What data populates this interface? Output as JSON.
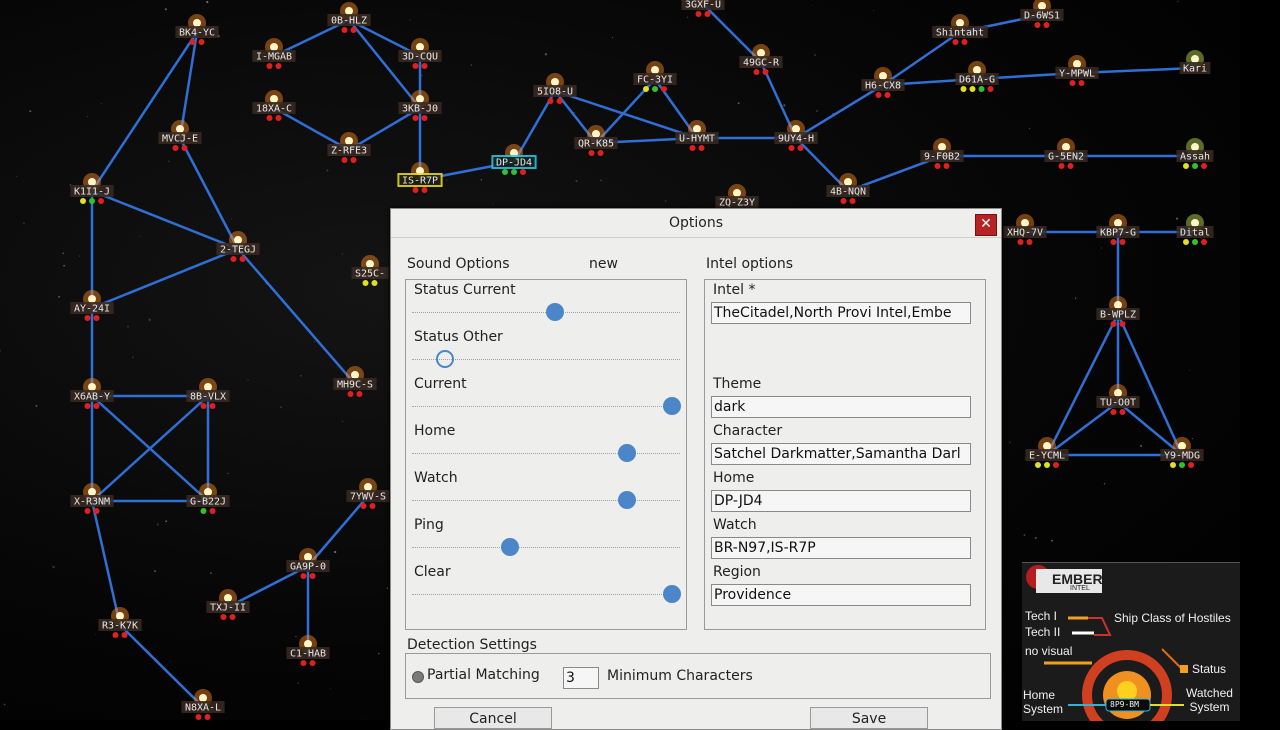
{
  "map": {
    "systems": [
      {
        "name": "BK4-YC",
        "dots": [
          "r",
          "r"
        ]
      },
      {
        "name": "0B-HLZ",
        "dots": [
          "r",
          "r"
        ]
      },
      {
        "name": "I-MGAB",
        "dots": [
          "r",
          "r"
        ]
      },
      {
        "name": "3D-CQU",
        "dots": [
          "r",
          "r"
        ]
      },
      {
        "name": "18XA-C",
        "dots": [
          "r",
          "r"
        ]
      },
      {
        "name": "3KB-J0",
        "dots": [
          "r",
          "r"
        ]
      },
      {
        "name": "MVCJ-E",
        "dots": [
          "r",
          "r"
        ]
      },
      {
        "name": "Z-RFE3",
        "dots": [
          "r",
          "r"
        ]
      },
      {
        "name": "IS-R7P",
        "dots": [
          "r",
          "r"
        ]
      },
      {
        "name": "DP-JD4",
        "dots": [
          "g",
          "g",
          "r"
        ]
      },
      {
        "name": "5IO8-U",
        "dots": [
          "r",
          "r"
        ]
      },
      {
        "name": "FC-3YI",
        "dots": [
          "y",
          "g",
          "r"
        ]
      },
      {
        "name": "QR-K85",
        "dots": [
          "r",
          "r"
        ]
      },
      {
        "name": "U-HYMT",
        "dots": [
          "r",
          "r"
        ]
      },
      {
        "name": "9UY4-H",
        "dots": [
          "r",
          "r"
        ]
      },
      {
        "name": "3GXF-U",
        "dots": [
          "r",
          "r"
        ]
      },
      {
        "name": "49GC-R",
        "dots": [
          "r",
          "r"
        ]
      },
      {
        "name": "Shintaht",
        "dots": [
          "r",
          "r"
        ]
      },
      {
        "name": "D-6WS1",
        "dots": [
          "r",
          "r"
        ]
      },
      {
        "name": "H6-CX8",
        "dots": [
          "r",
          "r"
        ]
      },
      {
        "name": "D61A-G",
        "dots": [
          "y",
          "y",
          "g",
          "r"
        ]
      },
      {
        "name": "Y-MPWL",
        "dots": [
          "r",
          "r"
        ]
      },
      {
        "name": "Kari",
        "dots": []
      },
      {
        "name": "9-F0B2",
        "dots": [
          "r",
          "r"
        ]
      },
      {
        "name": "G-5EN2",
        "dots": [
          "r",
          "r"
        ]
      },
      {
        "name": "Assah",
        "dots": [
          "y",
          "g",
          "r"
        ]
      },
      {
        "name": "4B-NQN",
        "dots": [
          "r",
          "r"
        ]
      },
      {
        "name": "ZQ-Z3Y",
        "dots": []
      },
      {
        "name": "XHQ-7V",
        "dots": [
          "r",
          "r"
        ]
      },
      {
        "name": "KBP7-G",
        "dots": [
          "r",
          "r"
        ]
      },
      {
        "name": "Dital",
        "dots": [
          "y",
          "g",
          "r"
        ]
      },
      {
        "name": "K1I1-J",
        "dots": [
          "y",
          "g",
          "r"
        ]
      },
      {
        "name": "2-TEGJ",
        "dots": [
          "r",
          "r"
        ]
      },
      {
        "name": "AY-24I",
        "dots": [
          "r",
          "r"
        ]
      },
      {
        "name": "S25C-",
        "dots": [
          "y",
          "y"
        ]
      },
      {
        "name": "MH9C-S",
        "dots": [
          "r",
          "r"
        ]
      },
      {
        "name": "X6AB-Y",
        "dots": [
          "r",
          "r"
        ]
      },
      {
        "name": "8B-VLX",
        "dots": [
          "r",
          "r"
        ]
      },
      {
        "name": "X-R3NM",
        "dots": [
          "r",
          "r"
        ]
      },
      {
        "name": "G-B22J",
        "dots": [
          "g",
          "r"
        ]
      },
      {
        "name": "7YWV-S",
        "dots": [
          "r",
          "r"
        ]
      },
      {
        "name": "GA9P-0",
        "dots": [
          "r",
          "r"
        ]
      },
      {
        "name": "TXJ-II",
        "dots": [
          "r",
          "r"
        ]
      },
      {
        "name": "R3-K7K",
        "dots": [
          "r",
          "r"
        ]
      },
      {
        "name": "C1-HAB",
        "dots": [
          "r",
          "r"
        ]
      },
      {
        "name": "N8XA-L",
        "dots": [
          "r",
          "r"
        ]
      },
      {
        "name": "B-WPLZ",
        "dots": [
          "r",
          "r"
        ]
      },
      {
        "name": "TU-O0T",
        "dots": [
          "r",
          "r"
        ]
      },
      {
        "name": "E-YCML",
        "dots": [
          "y",
          "y",
          "r"
        ]
      },
      {
        "name": "Y9-MDG",
        "dots": [
          "y",
          "g",
          "r"
        ]
      }
    ],
    "connections": [
      [
        "BK4-YC",
        "MVCJ-E"
      ],
      [
        "0B-HLZ",
        "I-MGAB"
      ],
      [
        "0B-HLZ",
        "3D-CQU"
      ],
      [
        "0B-HLZ",
        "3KB-J0"
      ],
      [
        "3D-CQU",
        "3KB-J0"
      ],
      [
        "18XA-C",
        "Z-RFE3"
      ],
      [
        "3KB-J0",
        "Z-RFE3"
      ],
      [
        "3KB-J0",
        "IS-R7P"
      ],
      [
        "IS-R7P",
        "DP-JD4"
      ],
      [
        "DP-JD4",
        "5IO8-U"
      ],
      [
        "5IO8-U",
        "QR-K85"
      ],
      [
        "5IO8-U",
        "U-HYMT"
      ],
      [
        "FC-3YI",
        "QR-K85"
      ],
      [
        "FC-3YI",
        "U-HYMT"
      ],
      [
        "QR-K85",
        "U-HYMT"
      ],
      [
        "U-HYMT",
        "9UY4-H"
      ],
      [
        "9UY4-H",
        "49GC-R"
      ],
      [
        "9UY4-H",
        "H6-CX8"
      ],
      [
        "9UY4-H",
        "4B-NQN"
      ],
      [
        "49GC-R",
        "3GXF-U"
      ],
      [
        "H6-CX8",
        "Shintaht"
      ],
      [
        "Shintaht",
        "D-6WS1"
      ],
      [
        "H6-CX8",
        "D61A-G"
      ],
      [
        "D61A-G",
        "Y-MPWL"
      ],
      [
        "Y-MPWL",
        "Kari"
      ],
      [
        "9-F0B2",
        "G-5EN2"
      ],
      [
        "G-5EN2",
        "Assah"
      ],
      [
        "4B-NQN",
        "9-F0B2"
      ],
      [
        "XHQ-7V",
        "KBP7-G"
      ],
      [
        "KBP7-G",
        "Dital"
      ],
      [
        "KBP7-G",
        "B-WPLZ"
      ],
      [
        "B-WPLZ",
        "TU-O0T"
      ],
      [
        "B-WPLZ",
        "E-YCML"
      ],
      [
        "B-WPLZ",
        "Y9-MDG"
      ],
      [
        "TU-O0T",
        "E-YCML"
      ],
      [
        "TU-O0T",
        "Y9-MDG"
      ],
      [
        "E-YCML",
        "Y9-MDG"
      ],
      [
        "MVCJ-E",
        "2-TEGJ"
      ],
      [
        "K1I1-J",
        "2-TEGJ"
      ],
      [
        "AY-24I",
        "2-TEGJ"
      ],
      [
        "K1I1-J",
        "AY-24I"
      ],
      [
        "AY-24I",
        "X6AB-Y"
      ],
      [
        "X6AB-Y",
        "8B-VLX"
      ],
      [
        "X6AB-Y",
        "X-R3NM"
      ],
      [
        "X6AB-Y",
        "G-B22J"
      ],
      [
        "8B-VLX",
        "X-R3NM"
      ],
      [
        "8B-VLX",
        "G-B22J"
      ],
      [
        "X-R3NM",
        "G-B22J"
      ],
      [
        "2-TEGJ",
        "MH9C-S"
      ],
      [
        "X-R3NM",
        "R3-K7K"
      ],
      [
        "R3-K7K",
        "N8XA-L"
      ],
      [
        "GA9P-0",
        "TXJ-II"
      ],
      [
        "GA9P-0",
        "C1-HAB"
      ],
      [
        "7YWV-S",
        "GA9P-0"
      ],
      [
        "K1I1-J",
        "BK4-YC"
      ]
    ],
    "highlight": {
      "home": "DP-JD4",
      "watch": "IS-R7P"
    },
    "colors": {
      "link": "#2f6fd6",
      "label_bg": "#3a2a22",
      "home": "#22d0e6",
      "watch": "#f0e020"
    }
  },
  "dialog": {
    "title": "Options",
    "close_symbol": "✕",
    "sound": {
      "heading": "Sound Options",
      "new_label": "new",
      "sliders": [
        {
          "label": "Status Current",
          "level": 0.53
        },
        {
          "label": "Status Other",
          "level": 0.09
        },
        {
          "label": "Current",
          "level": 1.0
        },
        {
          "label": "Home",
          "level": 0.82
        },
        {
          "label": "Watch",
          "level": 0.82
        },
        {
          "label": "Ping",
          "level": 0.35
        },
        {
          "label": "Clear",
          "level": 1.0
        }
      ]
    },
    "intel": {
      "heading": "Intel options",
      "intel_label": "Intel *",
      "intel_value": "TheCitadel,North Provi Intel,Embe",
      "theme_label": "Theme",
      "theme_value": "dark",
      "character_label": "Character",
      "character_value": "Satchel Darkmatter,Samantha Darl",
      "home_label": "Home",
      "home_value": "DP-JD4",
      "watch_label": "Watch",
      "watch_value": "BR-N97,IS-R7P",
      "region_label": "Region",
      "region_value": "Providence"
    },
    "detection": {
      "heading": "Detection Settings",
      "partial_label": "Partial Matching",
      "min_chars_value": "3",
      "min_chars_label": "Minimum Characters"
    },
    "cancel_label": "Cancel",
    "save_label": "Save"
  },
  "ember": {
    "logo_text": "EMBER",
    "logo_sub": "INTEL",
    "tech1": "Tech I",
    "tech2": "Tech II",
    "no_visual": "no visual",
    "ship_class": "Ship Class of Hostiles",
    "status": "Status",
    "home_system": "Home\nSystem",
    "watched_system": "Watched\nSystem",
    "center_label": "8P9-BM"
  }
}
